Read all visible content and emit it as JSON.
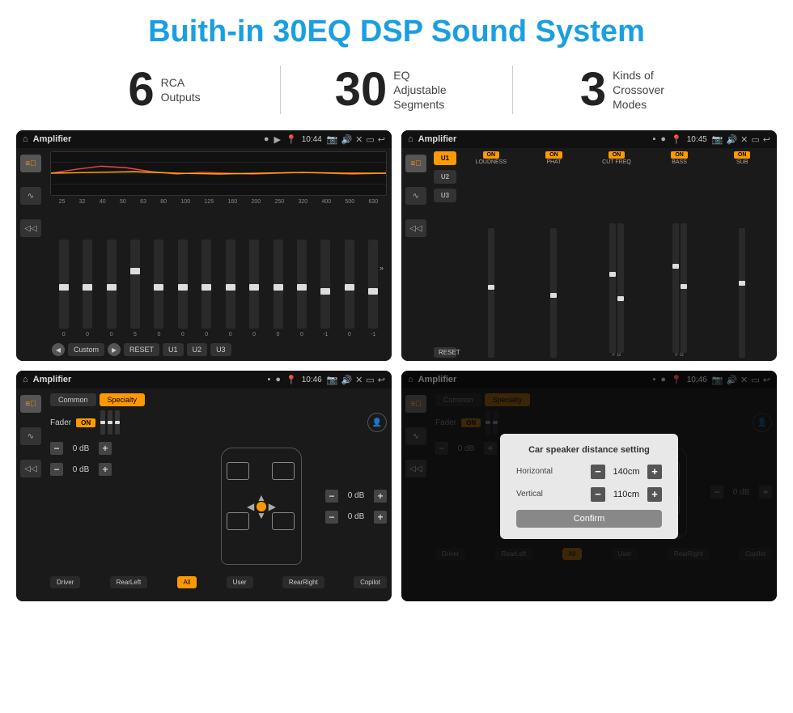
{
  "header": {
    "title": "Buith-in 30EQ DSP Sound System"
  },
  "stats": [
    {
      "number": "6",
      "text": "RCA\nOutputs"
    },
    {
      "number": "30",
      "text": "EQ Adjustable\nSegments"
    },
    {
      "number": "3",
      "text": "Kinds of\nCrossover Modes"
    }
  ],
  "screens": [
    {
      "id": "screen1",
      "title": "Amplifier",
      "time": "10:44",
      "type": "eq"
    },
    {
      "id": "screen2",
      "title": "Amplifier",
      "time": "10:45",
      "type": "amp2"
    },
    {
      "id": "screen3",
      "title": "Amplifier",
      "time": "10:46",
      "type": "fader"
    },
    {
      "id": "screen4",
      "title": "Amplifier",
      "time": "10:46",
      "type": "dialog"
    }
  ],
  "eq": {
    "freqs": [
      "25",
      "32",
      "40",
      "50",
      "63",
      "80",
      "100",
      "125",
      "160",
      "200",
      "250",
      "320",
      "400",
      "500",
      "630"
    ],
    "values": [
      "0",
      "0",
      "0",
      "5",
      "0",
      "0",
      "0",
      "0",
      "0",
      "0",
      "0",
      "-1",
      "0",
      "-1"
    ],
    "presets": [
      "Custom",
      "RESET",
      "U1",
      "U2",
      "U3"
    ]
  },
  "amp2": {
    "presets": [
      "U1",
      "U2",
      "U3"
    ],
    "channels": [
      "LOUDNESS",
      "PHAT",
      "CUT FREQ",
      "BASS",
      "SUB"
    ]
  },
  "fader": {
    "tabs": [
      "Common",
      "Specialty"
    ],
    "label": "Fader",
    "on_text": "ON",
    "db_values": [
      "0 dB",
      "0 dB",
      "0 dB",
      "0 dB"
    ],
    "locations": [
      "Driver",
      "RearLeft",
      "All",
      "User",
      "RearRight",
      "Copilot"
    ]
  },
  "dialog": {
    "title": "Car speaker distance setting",
    "horizontal_label": "Horizontal",
    "horizontal_value": "140cm",
    "vertical_label": "Vertical",
    "vertical_value": "110cm",
    "confirm_label": "Confirm",
    "tabs": [
      "Common",
      "Specialty"
    ],
    "fader_label": "Fader",
    "on_text": "ON",
    "db_values": [
      "0 dB",
      "0 dB"
    ],
    "locations": [
      "Driver",
      "RearLeft",
      "All",
      "User",
      "RearRight",
      "Copilot"
    ]
  }
}
